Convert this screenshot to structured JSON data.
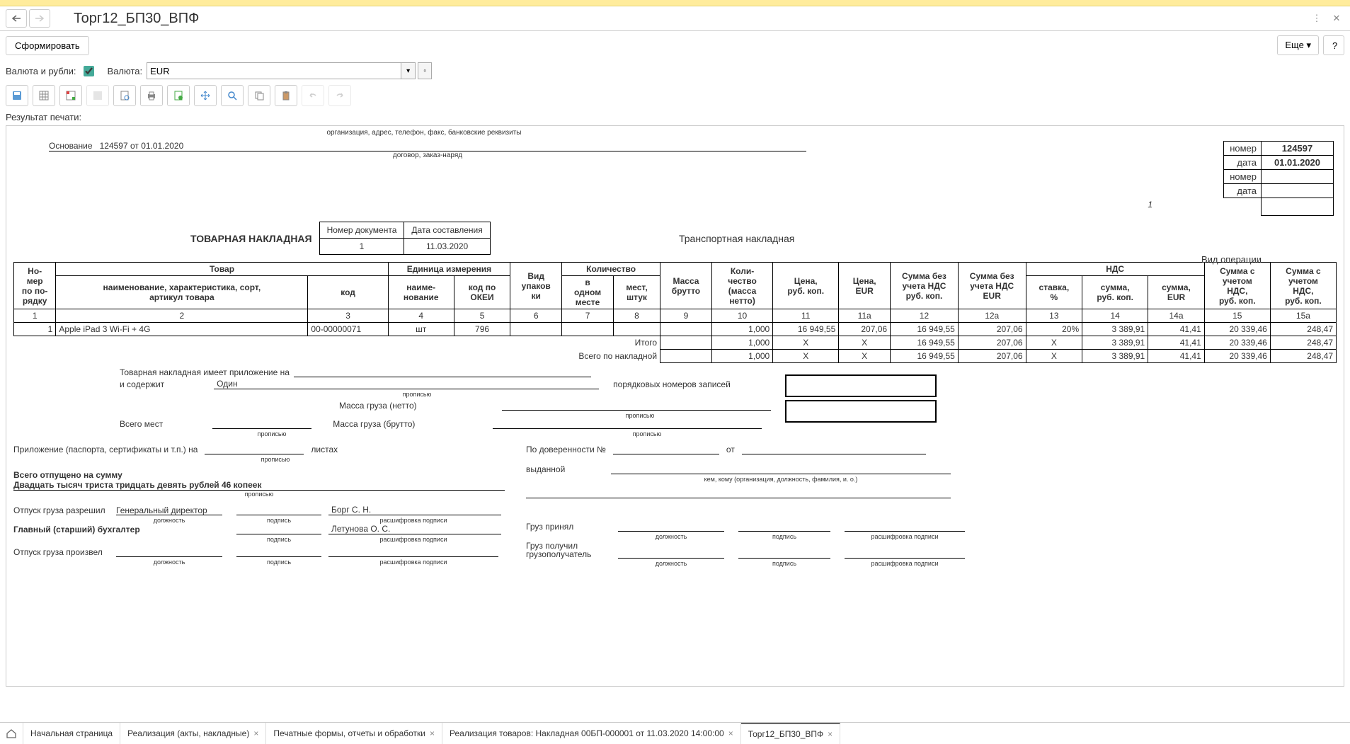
{
  "window": {
    "title": "Торг12_БП30_ВПФ"
  },
  "commands": {
    "form": "Сформировать",
    "more": "Еще"
  },
  "params": {
    "currency_rubles_label": "Валюта и рубли:",
    "currency_label": "Валюта:",
    "currency_value": "EUR"
  },
  "result_label": "Результат печати:",
  "doc": {
    "org_caption": "организация, адрес, телефон, факс, банковские реквизиты",
    "basis_label": "Основание",
    "basis_value": "124597 от 01.01.2020",
    "contract_caption": "договор, заказ-наряд",
    "title": "ТОВАРНАЯ НАКЛАДНАЯ",
    "doc_num_hdr": "Номер документа",
    "doc_date_hdr": "Дата составления",
    "doc_num": "1",
    "doc_date": "11.03.2020",
    "transport_label": "Транспортная накладная",
    "op_label": "Вид операции",
    "right_box": {
      "num_label": "номер",
      "num_val": "124597",
      "date_label": "дата",
      "date_val": "01.01.2020",
      "tn_num_label": "номер",
      "tn_date_label": "дата"
    },
    "page_num": "1"
  },
  "table": {
    "h": {
      "c1": "Но-\nмер\nпо по-\nрядку",
      "c2g": "Товар",
      "c2": "наименование, характеристика, сорт,\nартикул товара",
      "c3": "код",
      "c4g": "Единица измерения",
      "c4": "наиме-\nнование",
      "c5": "код по\nОКЕИ",
      "c6": "Вид\nупаков\nки",
      "c7g": "Количество",
      "c7": "в\nодном\nместе",
      "c8": "мест,\nштук",
      "c9": "Масса\nбрутто",
      "c10": "Коли-\nчество\n(масса\nнетто)",
      "c11": "Цена,\nруб. коп.",
      "c11a": "Цена,\nEUR",
      "c12": "Сумма без\nучета НДС\nруб. коп.",
      "c12a": "Сумма без\nучета НДС\nEUR",
      "c13g": "НДС",
      "c13": "ставка,\n%",
      "c14": "сумма,\nруб. коп.",
      "c14a": "сумма,\nEUR",
      "c15": "Сумма с\nучетом\nНДС,\nруб. коп.",
      "c15a": "Сумма с\nучетом\nНДС,\nруб. коп."
    },
    "nums": [
      "1",
      "2",
      "3",
      "4",
      "5",
      "6",
      "7",
      "8",
      "9",
      "10",
      "11",
      "11а",
      "12",
      "12а",
      "13",
      "14",
      "14а",
      "15",
      "15а"
    ],
    "rows": [
      {
        "n": "1",
        "name": "Apple iPad 3 Wi-Fi + 4G",
        "code": "00-00000071",
        "unit": "шт",
        "okei": "796",
        "pack": "",
        "inone": "",
        "places": "",
        "gross": "",
        "qty": "1,000",
        "price_rub": "16 949,55",
        "price_eur": "207,06",
        "sum_rub": "16 949,55",
        "sum_eur": "207,06",
        "vat_rate": "20%",
        "vat_rub": "3 389,91",
        "vat_eur": "41,41",
        "total_rub": "20 339,46",
        "total_eur": "248,47"
      }
    ],
    "totals": {
      "itogo_label": "Итого",
      "vsego_label": "Всего по накладной",
      "itogo": {
        "qty": "1,000",
        "price_rub": "Х",
        "price_eur": "Х",
        "sum_rub": "16 949,55",
        "sum_eur": "207,06",
        "vat_rate": "Х",
        "vat_rub": "3 389,91",
        "vat_eur": "41,41",
        "total_rub": "20 339,46",
        "total_eur": "248,47"
      },
      "vsego": {
        "qty": "1,000",
        "price_rub": "Х",
        "price_eur": "Х",
        "sum_rub": "16 949,55",
        "sum_eur": "207,06",
        "vat_rate": "Х",
        "vat_rub": "3 389,91",
        "vat_eur": "41,41",
        "total_rub": "20 339,46",
        "total_eur": "248,47"
      }
    }
  },
  "footer": {
    "attach_label": "Товарная накладная имеет приложение на",
    "contains_label": "и содержит",
    "contains_val": "Один",
    "seq_label": "порядковых номеров записей",
    "prop": "прописью",
    "mass_net": "Масса груза (нетто)",
    "mass_gross": "Масса груза (брутто)",
    "places_label": "Всего мест",
    "appendix_label": "Приложение (паспорта, сертификаты и т.п.) на",
    "sheets_label": "листах",
    "total_released": "Всего отпущено  на сумму",
    "total_words": "Двадцать тысяч триста тридцать девять рублей 46 копеек",
    "release_allowed": "Отпуск груза разрешил",
    "director": "Генеральный директор",
    "borg": "Борг С. Н.",
    "accountant": "Главный (старший) бухгалтер",
    "letunova": "Летунова О. С.",
    "release_done": "Отпуск груза произвел",
    "position": "должность",
    "signature": "подпись",
    "decode": "расшифровка подписи",
    "proxy": "По доверенности №",
    "from": "от",
    "issued": "выданной",
    "issued_caption": "кем, кому (организация, должность, фамилия, и. о.)",
    "cargo_accepted": "Груз принял",
    "cargo_received": "Груз получил\nгрузополучатель"
  },
  "tabs": [
    {
      "label": "Начальная страница",
      "closable": false,
      "active": false
    },
    {
      "label": "Реализация (акты, накладные)",
      "closable": true,
      "active": false
    },
    {
      "label": "Печатные формы, отчеты и обработки",
      "closable": true,
      "active": false
    },
    {
      "label": "Реализация товаров: Накладная 00БП-000001 от 11.03.2020 14:00:00",
      "closable": true,
      "active": false
    },
    {
      "label": "Торг12_БП30_ВПФ",
      "closable": true,
      "active": true
    }
  ]
}
